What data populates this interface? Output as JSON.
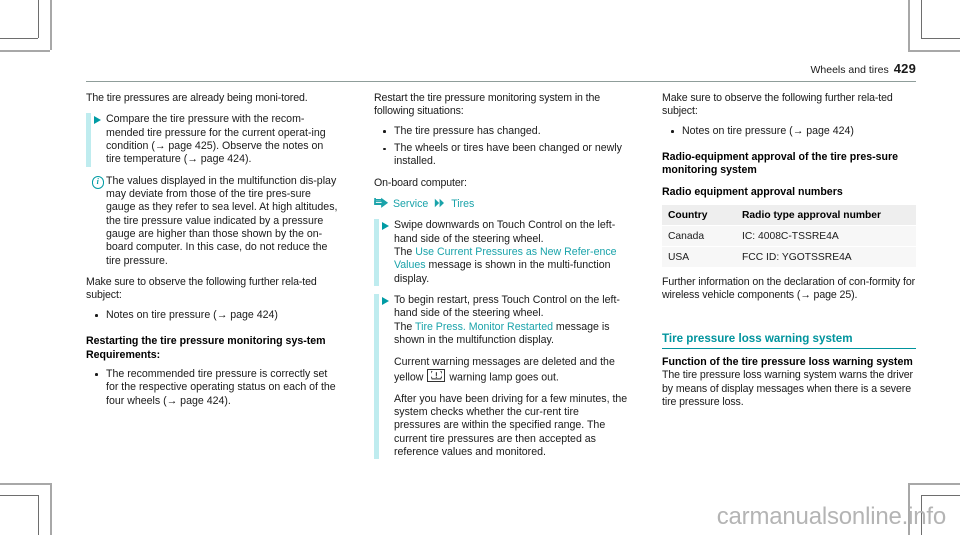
{
  "header": {
    "title": "Wheels and tires",
    "page_number": "429"
  },
  "watermark": "carmanualsonline.info",
  "columns": {
    "left": {
      "intro": "The tire pressures are already being moni-tored.",
      "step1": "Compare the tire pressure with the recom-mended tire pressure for the current operat-ing condition (→ page 425). Observe the notes on tire temperature (→ page 424).",
      "note1": "The values displayed in the multifunction dis-play may deviate from those of the tire pres-sure gauge as they refer to sea level. At high altitudes, the tire pressure value indicated by a pressure gauge are higher than those shown by the on-board computer. In this case, do not reduce the tire pressure.",
      "related_intro": "Make sure to observe the following further rela-ted subject:",
      "related_bullets": [
        "Notes on tire pressure (→ page 424)"
      ],
      "heading_restart": "Restarting the tire pressure monitoring sys-tem",
      "heading_requirements": "Requirements:",
      "requirement_bullets": [
        "The recommended tire pressure is correctly set for the respective operating status on each of the four wheels (→ page 424)."
      ]
    },
    "middle": {
      "restart_intro": "Restart the tire pressure monitoring system in the following situations:",
      "situation_bullets": [
        "The tire pressure has changed.",
        "The wheels or tires have been changed or newly installed."
      ],
      "onboard_label": "On-board computer:",
      "navpath": {
        "item1": "Service",
        "item2": "Tires"
      },
      "step_swipe": {
        "action": "Swipe downwards on Touch Control on the left-hand side of the steering wheel.",
        "result_pre": "The ",
        "result_link": "Use Current Pressures as New Refer-ence Values",
        "result_post": " message is shown in the multi-function display."
      },
      "step_restart": {
        "action": "To begin restart, press Touch Control on the left-hand side of the steering wheel.",
        "result_pre": "The ",
        "result_link": "Tire Press. Monitor Restarted",
        "result_post": " message is shown in the multifunction display.",
        "para2_pre": "Current warning messages are deleted and the yellow ",
        "para2_post": " warning lamp goes out.",
        "lamp_icon": "tpms-warning-lamp-icon",
        "para3": "After you have been driving for a few minutes, the system checks whether the cur-rent tire pressures are within the specified range. The current tire pressures are then accepted as reference values and monitored."
      }
    },
    "right": {
      "related_intro": "Make sure to observe the following further rela-ted subject:",
      "related_bullets": [
        "Notes on tire pressure (→ page 424)"
      ],
      "heading_radio_approval": "Radio-equipment approval of the tire pres-sure monitoring system",
      "heading_radio_numbers": "Radio equipment approval numbers",
      "table": {
        "columns": [
          "Country",
          "Radio type approval number"
        ],
        "rows": [
          [
            "Canada",
            "IC: 4008C-TSSRE4A"
          ],
          [
            "USA",
            "FCC ID: YGOTSSRE4A"
          ]
        ]
      },
      "further_info": "Further information on the declaration of con-formity for wireless vehicle components (→ page 25).",
      "section_heading": "Tire pressure loss warning system",
      "heading_function": "Function of the tire pressure loss warning system",
      "function_body": "The tire pressure loss warning system warns the driver by means of display messages when there is a severe tire pressure loss."
    }
  },
  "colors": {
    "teal": "#009ba4",
    "teal_link": "#1aa3aa",
    "step_bar": "#bfecef",
    "header_rule": "#8f9d9a",
    "table_header_bg": "#eeeeee",
    "table_cell_bg": "#f7f7f7",
    "watermark": "#b4b4b4"
  }
}
